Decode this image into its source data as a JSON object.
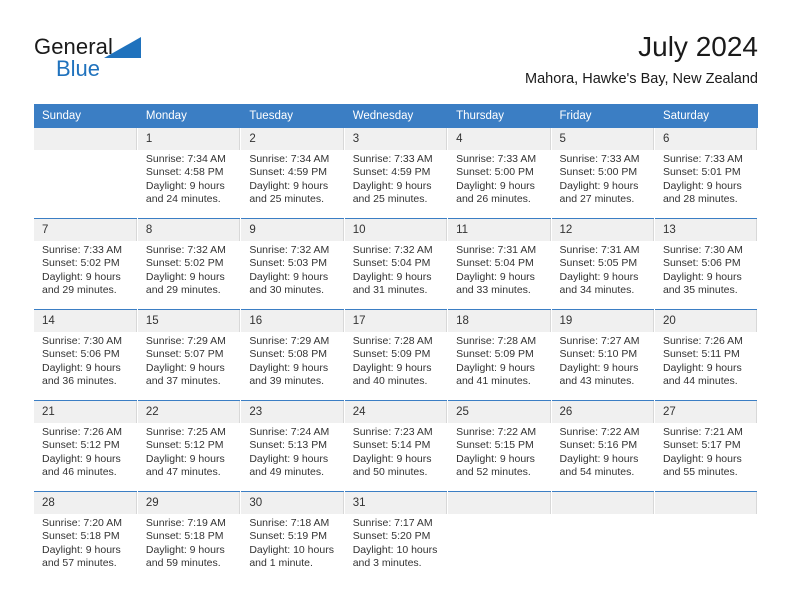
{
  "brand": {
    "name_part1": "General",
    "name_part2": "Blue",
    "accent_color": "#1f72bd",
    "flag_icon": "triangle-flag-icon"
  },
  "header": {
    "title": "July 2024",
    "subtitle": "Mahora, Hawke's Bay, New Zealand"
  },
  "calendar": {
    "header_color": "#3b7ec4",
    "daynum_band_color": "#f0f0f0",
    "weekday_headers": [
      "Sunday",
      "Monday",
      "Tuesday",
      "Wednesday",
      "Thursday",
      "Friday",
      "Saturday"
    ],
    "weeks": [
      [
        {
          "day": "",
          "empty": true,
          "sunrise": "",
          "sunset": "",
          "daylight_line1": "",
          "daylight_line2": ""
        },
        {
          "day": "1",
          "sunrise": "Sunrise: 7:34 AM",
          "sunset": "Sunset: 4:58 PM",
          "daylight_line1": "Daylight: 9 hours",
          "daylight_line2": "and 24 minutes."
        },
        {
          "day": "2",
          "sunrise": "Sunrise: 7:34 AM",
          "sunset": "Sunset: 4:59 PM",
          "daylight_line1": "Daylight: 9 hours",
          "daylight_line2": "and 25 minutes."
        },
        {
          "day": "3",
          "sunrise": "Sunrise: 7:33 AM",
          "sunset": "Sunset: 4:59 PM",
          "daylight_line1": "Daylight: 9 hours",
          "daylight_line2": "and 25 minutes."
        },
        {
          "day": "4",
          "sunrise": "Sunrise: 7:33 AM",
          "sunset": "Sunset: 5:00 PM",
          "daylight_line1": "Daylight: 9 hours",
          "daylight_line2": "and 26 minutes."
        },
        {
          "day": "5",
          "sunrise": "Sunrise: 7:33 AM",
          "sunset": "Sunset: 5:00 PM",
          "daylight_line1": "Daylight: 9 hours",
          "daylight_line2": "and 27 minutes."
        },
        {
          "day": "6",
          "sunrise": "Sunrise: 7:33 AM",
          "sunset": "Sunset: 5:01 PM",
          "daylight_line1": "Daylight: 9 hours",
          "daylight_line2": "and 28 minutes."
        }
      ],
      [
        {
          "day": "7",
          "sunrise": "Sunrise: 7:33 AM",
          "sunset": "Sunset: 5:02 PM",
          "daylight_line1": "Daylight: 9 hours",
          "daylight_line2": "and 29 minutes."
        },
        {
          "day": "8",
          "sunrise": "Sunrise: 7:32 AM",
          "sunset": "Sunset: 5:02 PM",
          "daylight_line1": "Daylight: 9 hours",
          "daylight_line2": "and 29 minutes."
        },
        {
          "day": "9",
          "sunrise": "Sunrise: 7:32 AM",
          "sunset": "Sunset: 5:03 PM",
          "daylight_line1": "Daylight: 9 hours",
          "daylight_line2": "and 30 minutes."
        },
        {
          "day": "10",
          "sunrise": "Sunrise: 7:32 AM",
          "sunset": "Sunset: 5:04 PM",
          "daylight_line1": "Daylight: 9 hours",
          "daylight_line2": "and 31 minutes."
        },
        {
          "day": "11",
          "sunrise": "Sunrise: 7:31 AM",
          "sunset": "Sunset: 5:04 PM",
          "daylight_line1": "Daylight: 9 hours",
          "daylight_line2": "and 33 minutes."
        },
        {
          "day": "12",
          "sunrise": "Sunrise: 7:31 AM",
          "sunset": "Sunset: 5:05 PM",
          "daylight_line1": "Daylight: 9 hours",
          "daylight_line2": "and 34 minutes."
        },
        {
          "day": "13",
          "sunrise": "Sunrise: 7:30 AM",
          "sunset": "Sunset: 5:06 PM",
          "daylight_line1": "Daylight: 9 hours",
          "daylight_line2": "and 35 minutes."
        }
      ],
      [
        {
          "day": "14",
          "sunrise": "Sunrise: 7:30 AM",
          "sunset": "Sunset: 5:06 PM",
          "daylight_line1": "Daylight: 9 hours",
          "daylight_line2": "and 36 minutes."
        },
        {
          "day": "15",
          "sunrise": "Sunrise: 7:29 AM",
          "sunset": "Sunset: 5:07 PM",
          "daylight_line1": "Daylight: 9 hours",
          "daylight_line2": "and 37 minutes."
        },
        {
          "day": "16",
          "sunrise": "Sunrise: 7:29 AM",
          "sunset": "Sunset: 5:08 PM",
          "daylight_line1": "Daylight: 9 hours",
          "daylight_line2": "and 39 minutes."
        },
        {
          "day": "17",
          "sunrise": "Sunrise: 7:28 AM",
          "sunset": "Sunset: 5:09 PM",
          "daylight_line1": "Daylight: 9 hours",
          "daylight_line2": "and 40 minutes."
        },
        {
          "day": "18",
          "sunrise": "Sunrise: 7:28 AM",
          "sunset": "Sunset: 5:09 PM",
          "daylight_line1": "Daylight: 9 hours",
          "daylight_line2": "and 41 minutes."
        },
        {
          "day": "19",
          "sunrise": "Sunrise: 7:27 AM",
          "sunset": "Sunset: 5:10 PM",
          "daylight_line1": "Daylight: 9 hours",
          "daylight_line2": "and 43 minutes."
        },
        {
          "day": "20",
          "sunrise": "Sunrise: 7:26 AM",
          "sunset": "Sunset: 5:11 PM",
          "daylight_line1": "Daylight: 9 hours",
          "daylight_line2": "and 44 minutes."
        }
      ],
      [
        {
          "day": "21",
          "sunrise": "Sunrise: 7:26 AM",
          "sunset": "Sunset: 5:12 PM",
          "daylight_line1": "Daylight: 9 hours",
          "daylight_line2": "and 46 minutes."
        },
        {
          "day": "22",
          "sunrise": "Sunrise: 7:25 AM",
          "sunset": "Sunset: 5:12 PM",
          "daylight_line1": "Daylight: 9 hours",
          "daylight_line2": "and 47 minutes."
        },
        {
          "day": "23",
          "sunrise": "Sunrise: 7:24 AM",
          "sunset": "Sunset: 5:13 PM",
          "daylight_line1": "Daylight: 9 hours",
          "daylight_line2": "and 49 minutes."
        },
        {
          "day": "24",
          "sunrise": "Sunrise: 7:23 AM",
          "sunset": "Sunset: 5:14 PM",
          "daylight_line1": "Daylight: 9 hours",
          "daylight_line2": "and 50 minutes."
        },
        {
          "day": "25",
          "sunrise": "Sunrise: 7:22 AM",
          "sunset": "Sunset: 5:15 PM",
          "daylight_line1": "Daylight: 9 hours",
          "daylight_line2": "and 52 minutes."
        },
        {
          "day": "26",
          "sunrise": "Sunrise: 7:22 AM",
          "sunset": "Sunset: 5:16 PM",
          "daylight_line1": "Daylight: 9 hours",
          "daylight_line2": "and 54 minutes."
        },
        {
          "day": "27",
          "sunrise": "Sunrise: 7:21 AM",
          "sunset": "Sunset: 5:17 PM",
          "daylight_line1": "Daylight: 9 hours",
          "daylight_line2": "and 55 minutes."
        }
      ],
      [
        {
          "day": "28",
          "sunrise": "Sunrise: 7:20 AM",
          "sunset": "Sunset: 5:18 PM",
          "daylight_line1": "Daylight: 9 hours",
          "daylight_line2": "and 57 minutes."
        },
        {
          "day": "29",
          "sunrise": "Sunrise: 7:19 AM",
          "sunset": "Sunset: 5:18 PM",
          "daylight_line1": "Daylight: 9 hours",
          "daylight_line2": "and 59 minutes."
        },
        {
          "day": "30",
          "sunrise": "Sunrise: 7:18 AM",
          "sunset": "Sunset: 5:19 PM",
          "daylight_line1": "Daylight: 10 hours",
          "daylight_line2": "and 1 minute."
        },
        {
          "day": "31",
          "sunrise": "Sunrise: 7:17 AM",
          "sunset": "Sunset: 5:20 PM",
          "daylight_line1": "Daylight: 10 hours",
          "daylight_line2": "and 3 minutes."
        },
        {
          "day": "",
          "empty": true,
          "sunrise": "",
          "sunset": "",
          "daylight_line1": "",
          "daylight_line2": ""
        },
        {
          "day": "",
          "empty": true,
          "sunrise": "",
          "sunset": "",
          "daylight_line1": "",
          "daylight_line2": ""
        },
        {
          "day": "",
          "empty": true,
          "sunrise": "",
          "sunset": "",
          "daylight_line1": "",
          "daylight_line2": ""
        }
      ]
    ]
  }
}
